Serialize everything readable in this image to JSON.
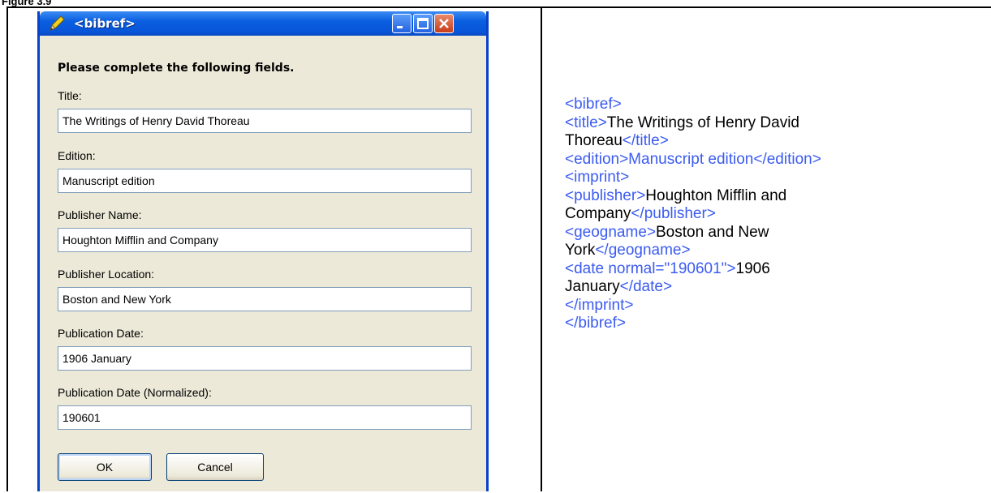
{
  "figure_label": "Figure 3.9",
  "dialog": {
    "title": "<bibref>",
    "instruction": "Please complete the following fields.",
    "fields": [
      {
        "label": "Title:",
        "value": "The Writings of Henry David Thoreau"
      },
      {
        "label": "Edition:",
        "value": "Manuscript edition"
      },
      {
        "label": "Publisher Name:",
        "value": "Houghton Mifflin and Company"
      },
      {
        "label": "Publisher Location:",
        "value": "Boston and New York"
      },
      {
        "label": "Publication Date:",
        "value": "1906 January"
      },
      {
        "label": "Publication Date (Normalized):",
        "value": "190601"
      }
    ],
    "ok_label": "OK",
    "cancel_label": "Cancel"
  },
  "xml": {
    "l1_tag": "<bibref>",
    "l2_tag_open": "<title>",
    "l2_text": "The Writings of Henry David",
    "l3_text": "Thoreau",
    "l3_tag_close": "</title>",
    "l4_tag": "<edition>Manuscript edition</edition>",
    "l5_tag": "<imprint>",
    "l6_tag_open": "<publisher>",
    "l6_text": "Houghton Mifflin and",
    "l7_text": "Company",
    "l7_tag_close": "</publisher>",
    "l8_tag_open": "<geogname>",
    "l8_text": "Boston and New",
    "l9_text": "York",
    "l9_tag_close": "</geogname>",
    "l10_tag_open": "<date normal=\"190601\">",
    "l10_text": "1906",
    "l11_text": "January",
    "l11_tag_close": "</date>",
    "l12_tag": "</imprint>",
    "l13_tag": "</bibref>"
  },
  "colors": {
    "xml_tag": "#3b5bf0",
    "titlebar": "#0854d8",
    "dialog_bg": "#ece9d8"
  }
}
